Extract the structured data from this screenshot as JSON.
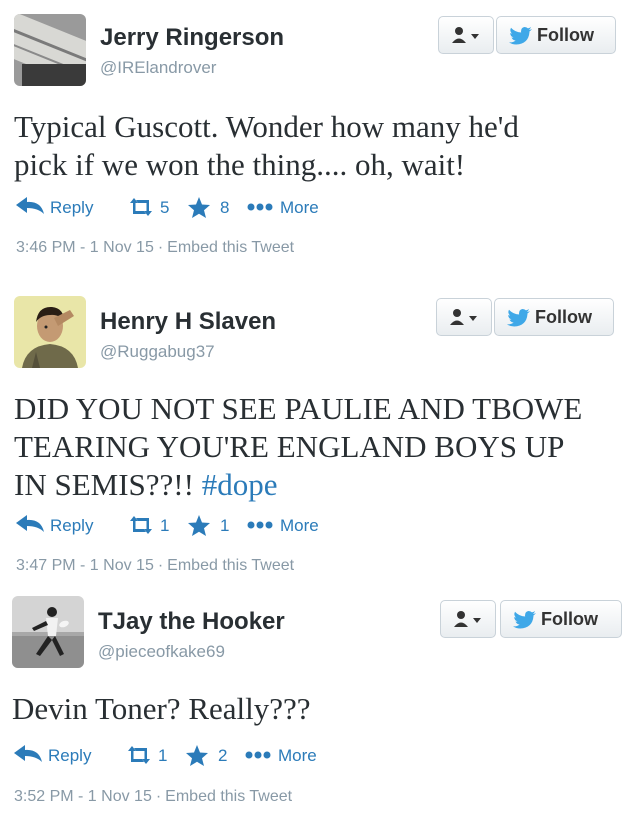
{
  "colors": {
    "link": "#2b7bb9",
    "muted": "#8899a6",
    "text": "#292f33"
  },
  "tweets": [
    {
      "name": "Jerry Ringerson",
      "handle": "@IRElandrover",
      "text_lines": [
        "Typical Guscott. Wonder how many he'd",
        "pick if we won the thing.... oh, wait!"
      ],
      "hashtag": "",
      "reply_label": "Reply",
      "retweets": "5",
      "favorites": "8",
      "more_label": "More",
      "follow_label": "Follow",
      "time": "3:46 PM - 1 Nov 15",
      "embed_label": "Embed this Tweet",
      "avatar_icon": "book-avatar"
    },
    {
      "name": "Henry H Slaven",
      "handle": "@Ruggabug37",
      "text_lines": [
        "DID YOU NOT SEE PAULIE AND TBOWE",
        "TEARING YOU'RE ENGLAND BOYS UP",
        "IN SEMIS??!! "
      ],
      "hashtag": "#dope",
      "reply_label": "Reply",
      "retweets": "1",
      "favorites": "1",
      "more_label": "More",
      "follow_label": "Follow",
      "time": "3:47 PM - 1 Nov 15",
      "embed_label": "Embed this Tweet",
      "avatar_icon": "person-avatar"
    },
    {
      "name": "TJay the Hooker",
      "handle": "@pieceofkake69",
      "text_lines": [
        "Devin Toner? Really???"
      ],
      "hashtag": "",
      "reply_label": "Reply",
      "retweets": "1",
      "favorites": "2",
      "more_label": "More",
      "follow_label": "Follow",
      "time": "3:52 PM - 1 Nov 15",
      "embed_label": "Embed this Tweet",
      "avatar_icon": "rugby-player-avatar"
    }
  ]
}
